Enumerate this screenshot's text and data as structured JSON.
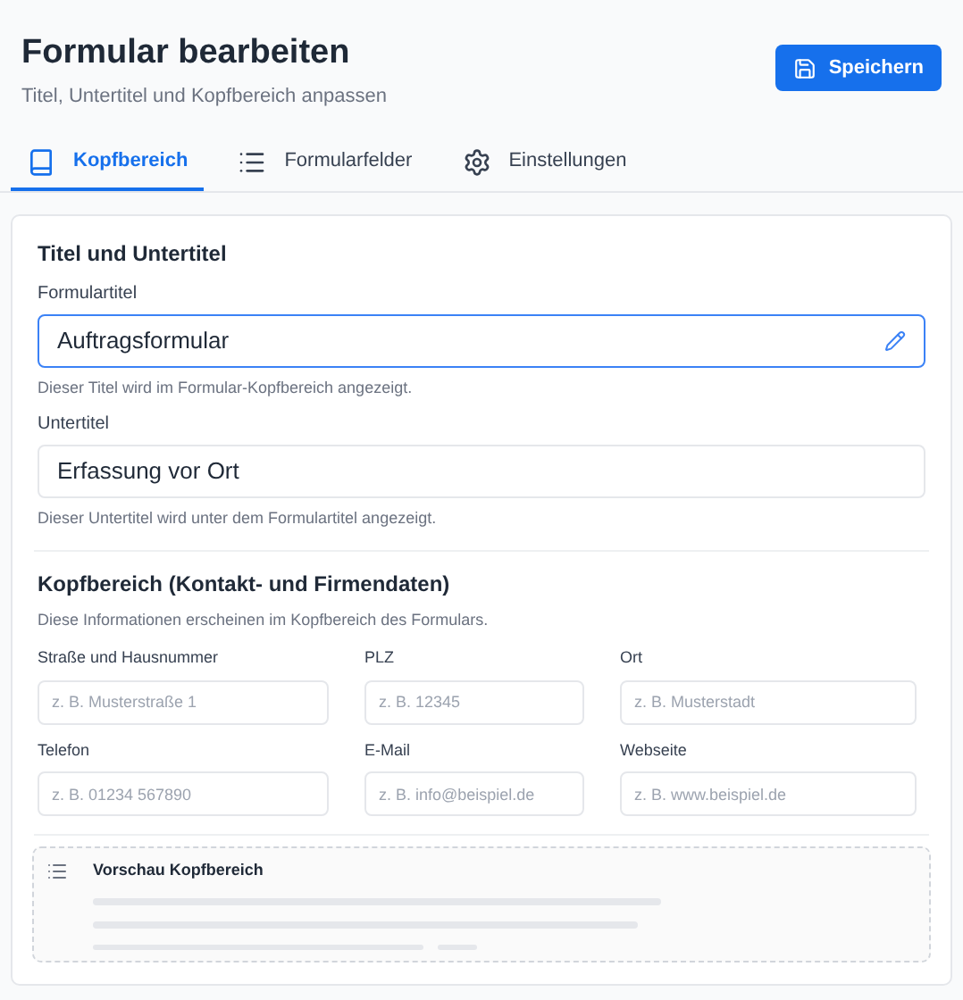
{
  "header": {
    "title": "Formular bearbeiten",
    "subtitle": "Titel, Untertitel und Kopfbereich anpassen",
    "save_button": "Speichern"
  },
  "tabs": [
    {
      "label": "Kopfbereich",
      "kind": "book",
      "selected": true
    },
    {
      "label": "Formularfelder",
      "kind": "list",
      "selected": false
    },
    {
      "label": "Einstellungen",
      "kind": "gear",
      "selected": false
    }
  ],
  "title_section": {
    "heading": "Titel und Untertitel",
    "fields": [
      {
        "label": "Formulartitel",
        "value": "Auftragsformular",
        "focused": true,
        "hint": "Dieser Titel wird im Formular-Kopfbereich angezeigt."
      },
      {
        "label": "Untertitel",
        "value": "Erfassung vor Ort",
        "focused": false,
        "hint": "Dieser Untertitel wird unter dem Formulartitel angezeigt."
      }
    ]
  },
  "header_section": {
    "heading": "Kopfbereich (Kontakt- und Firmendaten)",
    "description": "Diese Informationen erscheinen im Kopfbereich des Formulars.",
    "fields": [
      {
        "label": "Straße und Hausnummer",
        "placeholder": "z. B. Musterstraße 1"
      },
      {
        "label": "PLZ",
        "placeholder": "z. B. 12345"
      },
      {
        "label": "Ort",
        "placeholder": "z. B. Musterstadt"
      },
      {
        "label": "Telefon",
        "placeholder": "z. B. 01234 567890"
      },
      {
        "label": "E-Mail",
        "placeholder": "z. B. info@beispiel.de"
      },
      {
        "label": "Webseite",
        "placeholder": "z. B. www.beispiel.de"
      }
    ]
  },
  "preview": {
    "title": "Vorschau Kopfbereich"
  }
}
